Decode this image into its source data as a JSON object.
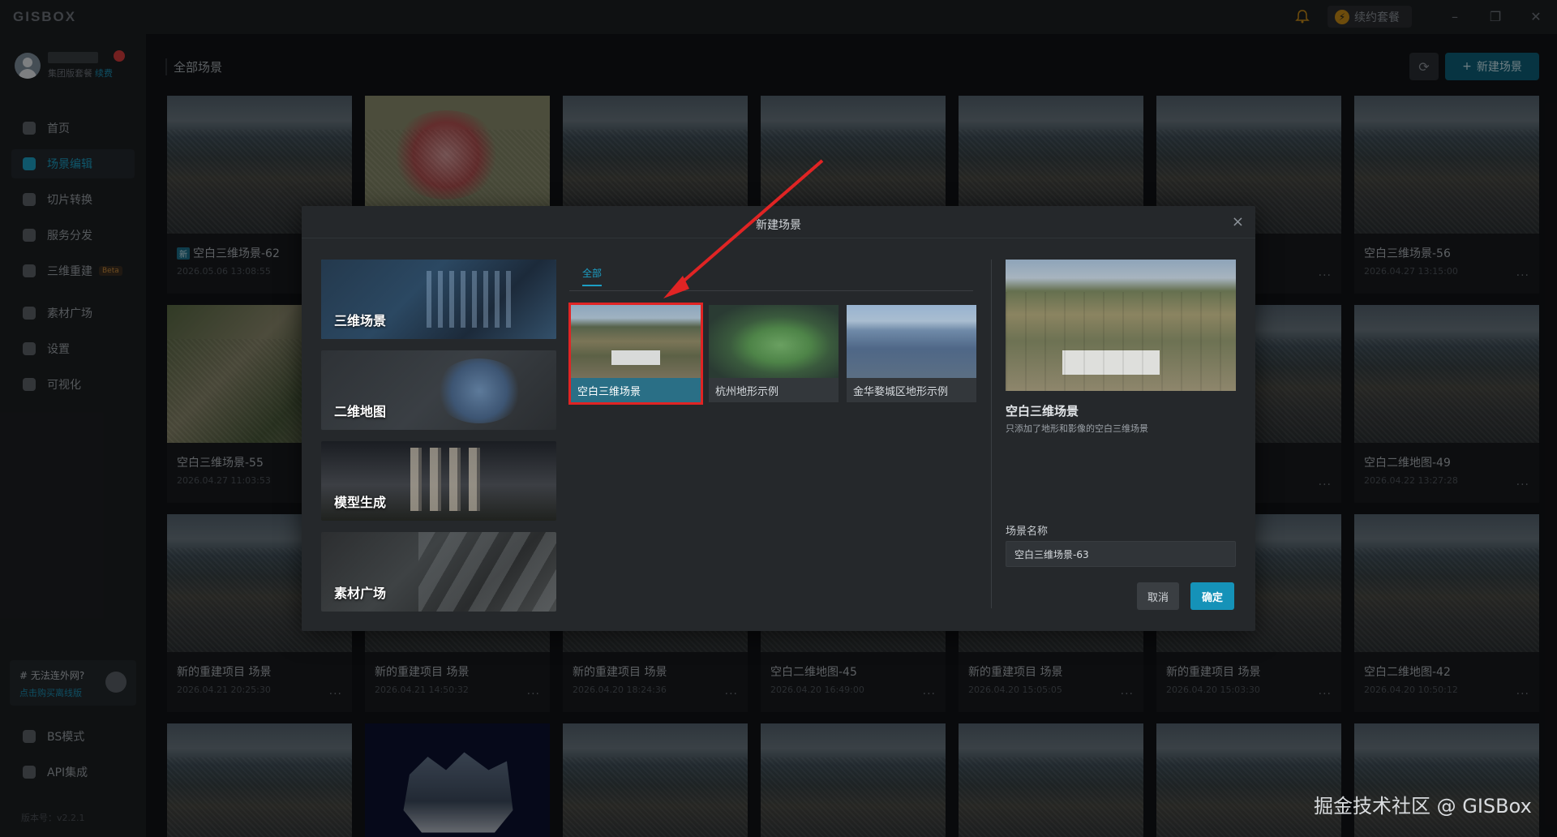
{
  "app": {
    "logo": "GISBOX",
    "plan_button": "续约套餐",
    "plan_icon": "⚡"
  },
  "sidebar": {
    "user_plan": "集团版套餐",
    "renew": "续费",
    "nav": [
      {
        "label": "首页",
        "icon": "home-icon"
      },
      {
        "label": "场景编辑",
        "icon": "cube-icon"
      },
      {
        "label": "切片转换",
        "icon": "convert-icon"
      },
      {
        "label": "服务分发",
        "icon": "upload-icon"
      },
      {
        "label": "三维重建",
        "icon": "rebuild-icon",
        "beta": "Beta"
      },
      {
        "label": "素材广场",
        "icon": "image-icon"
      },
      {
        "label": "设置",
        "icon": "settings-icon"
      },
      {
        "label": "可视化",
        "icon": "chart-icon"
      }
    ],
    "promo_title": "# 无法连外网?",
    "promo_link": "点击购买离线版",
    "bottom_nav": [
      {
        "label": "BS模式",
        "icon": "browser-icon"
      },
      {
        "label": "API集成",
        "icon": "link-icon"
      }
    ],
    "version": "版本号：v2.2.1"
  },
  "main": {
    "breadcrumb": "全部场景",
    "new_button": "新建场景",
    "new_icon": "+",
    "refresh_icon": "⟳",
    "cards": [
      {
        "title": "空白三维场景-62",
        "date": "2026.05.06 13:08:55",
        "tag": "新",
        "more": ""
      },
      {
        "title": "空白三维场景-56",
        "date": "2026.04.27 13:15:00",
        "tag": "",
        "more": "..."
      },
      {
        "title": "空白三维场景-55",
        "date": "2026.04.27 11:03:53",
        "tag": "",
        "more": ""
      },
      {
        "title": "空白二维地图-49",
        "date": "2026.04.22 13:27:28",
        "tag": "",
        "more": "..."
      },
      {
        "title": "新的重建项目 场景",
        "date": "2026.04.21 20:25:30",
        "tag": "",
        "more": "..."
      },
      {
        "title": "新的重建项目 场景",
        "date": "2026.04.21 14:50:32",
        "tag": "",
        "more": "..."
      },
      {
        "title": "新的重建项目 场景",
        "date": "2026.04.20 18:24:36",
        "tag": "",
        "more": "..."
      },
      {
        "title": "空白二维地图-45",
        "date": "2026.04.20 16:49:00",
        "tag": "",
        "more": "..."
      },
      {
        "title": "新的重建项目 场景",
        "date": "2026.04.20 15:05:05",
        "tag": "",
        "more": "..."
      },
      {
        "title": "新的重建项目 场景",
        "date": "2026.04.20 15:03:30",
        "tag": "",
        "more": "..."
      },
      {
        "title": "空白二维地图-42",
        "date": "2026.04.20 10:50:12",
        "tag": "",
        "more": "..."
      }
    ],
    "row1_more": [
      "...",
      "..."
    ]
  },
  "dialog": {
    "title": "新建场景",
    "close": "×",
    "categories": [
      "三维场景",
      "二维地图",
      "模型生成",
      "素材广场"
    ],
    "tab_all": "全部",
    "templates": [
      "空白三维场景",
      "杭州地形示例",
      "金华婺城区地形示例"
    ],
    "preview_title": "空白三维场景",
    "preview_desc": "只添加了地形和影像的空白三维场景",
    "name_label": "场景名称",
    "name_value": "空白三维场景-63",
    "cancel": "取消",
    "confirm": "确定"
  },
  "watermark": "掘金技术社区 @ GISBox",
  "colors": {
    "accent": "#1592b8",
    "highlight": "#e02424"
  }
}
